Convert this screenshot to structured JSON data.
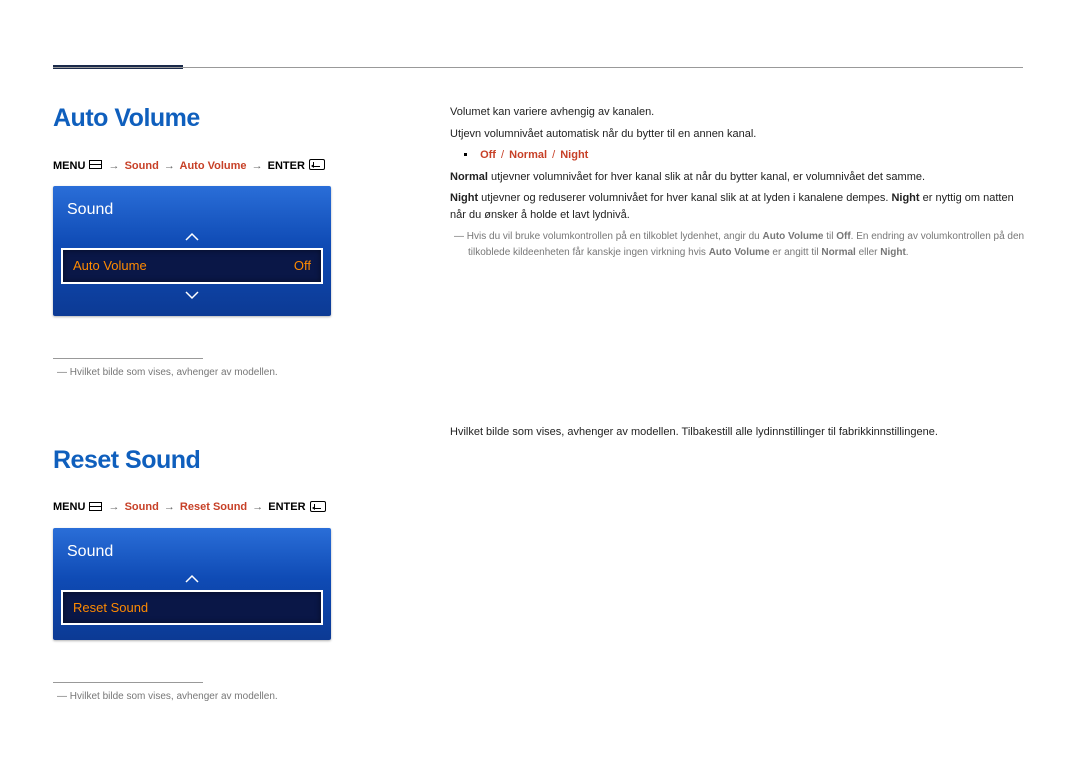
{
  "sections": {
    "autoVolume": {
      "title": "Auto Volume",
      "breadcrumb": {
        "menu": "MENU",
        "path1": "Sound",
        "path2": "Auto Volume",
        "enter": "ENTER"
      },
      "panel": {
        "title": "Sound",
        "row_label": "Auto Volume",
        "row_value": "Off"
      },
      "footnote": "Hvilket bilde som vises, avhenger av modellen."
    },
    "resetSound": {
      "title": "Reset Sound",
      "breadcrumb": {
        "menu": "MENU",
        "path1": "Sound",
        "path2": "Reset Sound",
        "enter": "ENTER"
      },
      "panel": {
        "title": "Sound",
        "row_label": "Reset Sound"
      },
      "footnote": "Hvilket bilde som vises, avhenger av modellen."
    }
  },
  "right": {
    "p1": "Volumet kan variere avhengig av kanalen.",
    "p2": "Utjevn volumnivået automatisk når du bytter til en annen kanal.",
    "options": {
      "off": "Off",
      "normal": "Normal",
      "night": "Night"
    },
    "normal_term": "Normal",
    "normal_text": " utjevner volumnivået for hver kanal slik at når du bytter kanal, er volumnivået det samme.",
    "night_term": "Night",
    "night_text_a": " utjevner og reduserer volumnivået for hver kanal slik at at lyden i kanalene dempes. ",
    "night_term2": "Night",
    "night_text_b": " er nyttig om natten når du ønsker å holde et lavt lydnivå.",
    "note_a": "Hvis du vil bruke volumkontrollen på en tilkoblet lydenhet, angir du ",
    "note_av": "Auto Volume",
    "note_b": " til ",
    "note_off": "Off",
    "note_c": ". En endring av volumkontrollen på den tilkoblede kildeenheten får kanskje ingen virkning hvis ",
    "note_av2": "Auto Volume",
    "note_d": " er angitt til ",
    "note_normal": "Normal",
    "note_e": " eller ",
    "note_night": "Night",
    "note_f": ".",
    "reset_desc": "Hvilket bilde som vises, avhenger av modellen. Tilbakestill alle lydinnstillinger til fabrikkinnstillingene."
  }
}
